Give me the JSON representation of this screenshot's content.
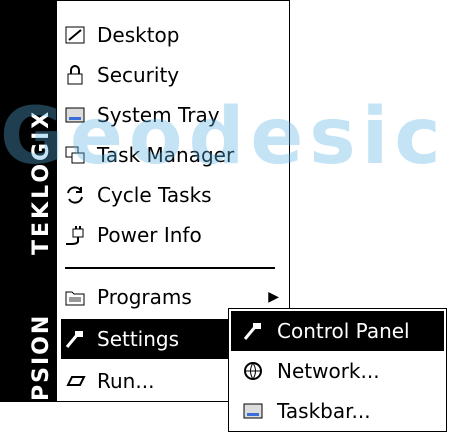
{
  "watermark": "Geodesic",
  "brand": {
    "name": "TEKLOGIX",
    "name2": "PSION"
  },
  "menu": {
    "items": [
      {
        "label": "Desktop",
        "icon": "desktop-icon"
      },
      {
        "label": "Security",
        "icon": "lock-icon"
      },
      {
        "label": "System Tray",
        "icon": "system-tray-icon"
      },
      {
        "label": "Task Manager",
        "icon": "task-manager-icon"
      },
      {
        "label": "Cycle Tasks",
        "icon": "cycle-icon"
      },
      {
        "label": "Power Info",
        "icon": "power-plug-icon"
      },
      {
        "label": "Programs",
        "icon": "programs-folder-icon"
      },
      {
        "label": "Settings",
        "icon": "settings-icon"
      },
      {
        "label": "Run...",
        "icon": "run-icon"
      }
    ]
  },
  "submenu": {
    "items": [
      {
        "label": "Control Panel",
        "icon": "control-panel-icon"
      },
      {
        "label": "Network...",
        "icon": "network-icon"
      },
      {
        "label": "Taskbar...",
        "icon": "taskbar-icon"
      }
    ]
  },
  "colors": {
    "watermark": "#5ab4e6",
    "selection": "#000000",
    "brand_bg": "#000000"
  }
}
